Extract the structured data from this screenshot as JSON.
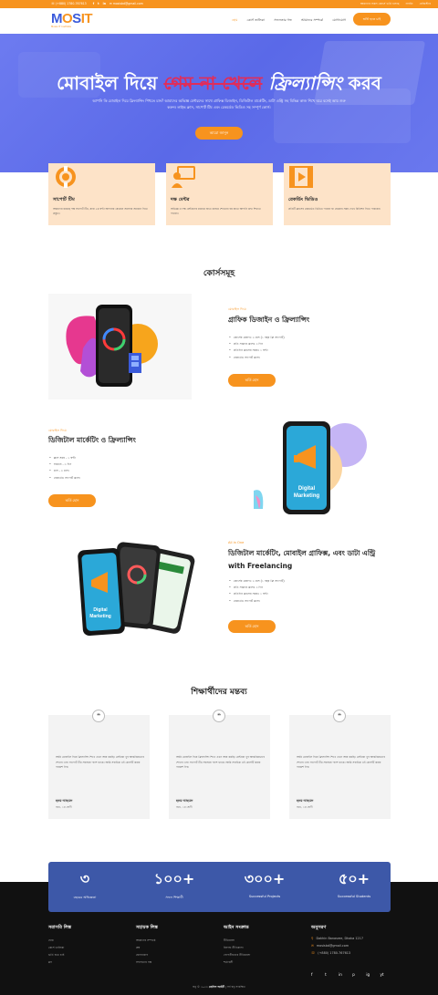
{
  "topbar": {
    "phone": "(+880) 1780-767613",
    "email": "mosisbd@gmail.com",
    "socials": [
      "f",
      "t",
      "in"
    ],
    "notice": "আমাদের সকল কোর্সে ভর্তি চলছে",
    "login": "লগইন",
    "register": "রেজিস্টার"
  },
  "logo": {
    "m": "M",
    "o": "O",
    "s": "S",
    "t": "IT",
    "tagline": "Mosis IT Institute"
  },
  "nav": {
    "items": [
      "হোম",
      "কোর্স তালিকা",
      "সফলতার গল্প",
      "আমাদের সম্পর্কে",
      "যোগাযোগ"
    ],
    "cta": "ভর্তি হতে চাই"
  },
  "hero": {
    "title_a": "মোবাইল দিয়ে",
    "title_strike": "গেম না খেলে",
    "title_b": "ফ্রিল্যান্সিং",
    "title_c": "করব",
    "desc": "আপনি কি মোবাইল দিয়ে ফ্রিল্যান্সিং শিখতে চান? আমাদের অভিজ্ঞ মেন্টরদের সাথে গ্রাফিক্স ডিজাইন, ডিজিটাল মার্কেটিং, ডাটা এন্ট্রি সহ বিভিন্ন কাজ শিখে ঘরে বসেই আয় শুরু করুন। লাইভ ক্লাস, সাপোর্ট টিম এবং রেকর্ডেড ভিডিও সহ সম্পূর্ণ কোর্স।",
    "button": "আরো জানুন"
  },
  "features": [
    {
      "icon": "support-icon",
      "title": "সাপোর্ট টিম",
      "desc": "আমাদের রয়েছে দক্ষ সাপোর্ট টিম, যারা ২৪ ঘন্টা আপনার যেকোন সমস্যার সমাধান দিতে প্রস্তুত।"
    },
    {
      "icon": "mentor-icon",
      "title": "দক্ষ মেন্টর",
      "desc": "অভিজ্ঞ ও দক্ষ মেন্টরদের মাধ্যমে হাতে কলমে শেখানো হয় যাতে আপনি দ্রুত শিখতে পারেন।"
    },
    {
      "icon": "video-icon",
      "title": "রেকর্ডিং ভিডিও",
      "desc": "প্রতিটি ক্লাসের রেকর্ডেড ভিডিও পাবেন যা যেকোন সময় দেখে রিভিশন দিতে পারবেন।"
    }
  ],
  "courses": {
    "section_title": "কোর্সসমূহ",
    "items": [
      {
        "tag": "মোবাইল দিয়ে",
        "title": "গ্রাফিক ডিজাইন ও ফ্রিল্যান্সিং",
        "points": [
          "কোর্সের মেয়াদঃ ৩ মাস (১ বছর ফ্রি সাপোর্ট)",
          "প্রতি সপ্তাহে ক্লাসঃ ৩ দিন",
          "প্রতিদিন ক্লাসের সময়ঃ ১ ঘন্টা",
          "রেকর্ডেড সাপোর্ট ক্লাস।"
        ],
        "button": "ভর্তি হোন"
      },
      {
        "tag": "মোবাইল দিয়ে",
        "title": "ডিজিটাল মার্কেটিং ও ফ্রিল্যান্সিং",
        "points": [
          "ক্লাস সময় - ১ ঘণ্টা",
          "সপ্তাহে - ৩ দিন",
          "মাস - ৩ মাস।",
          "রেকর্ডেড সাপোর্ট ক্লাস।"
        ],
        "button": "ভর্তি হোন",
        "phone_label": "Digital Marketing"
      },
      {
        "tag": "All in One",
        "title": "ডিজিটাল মার্কেটিং, মোবাইল গ্রাফিক্স, এবং ডাটা এন্ট্রি with Freelancing",
        "points": [
          "কোর্সের মেয়াদঃ ৩ মাস (১ বছর ফ্রি সাপোর্ট)",
          "প্রতি সপ্তাহে ক্লাসঃ ৩ দিন",
          "প্রতিদিন ক্লাসের সময়ঃ ১ ঘন্টা",
          "রেকর্ডেড সাপোর্ট ক্লাস।"
        ],
        "button": "ভর্তি হোন",
        "phone_label": "Digital Marketing"
      }
    ]
  },
  "testimonials": {
    "section_title": "শিক্ষার্থীদের মন্তব্য",
    "items": [
      {
        "text": "আমি মোবাইল দিয়ে ফ্রিল্যান্সিং শিখে এখন আয় করছি। মেন্টররা খুব আন্তরিকভাবে শেখান এবং সাপোর্ট টিম সবসময় পাশে থাকে। আমি সবাইকে এই কোর্সটি করার পরামর্শ দিব।",
        "name": "হৃদয় আহমেদ",
        "batch": "ব্যাচ, ১ম শ্রেণী"
      },
      {
        "text": "আমি মোবাইল দিয়ে ফ্রিল্যান্সিং শিখে এখন আয় করছি। মেন্টররা খুব আন্তরিকভাবে শেখান এবং সাপোর্ট টিম সবসময় পাশে থাকে। আমি সবাইকে এই কোর্সটি করার পরামর্শ দিব।",
        "name": "হৃদয় আহমেদ",
        "batch": "ব্যাচ, ১ম শ্রেণী"
      },
      {
        "text": "আমি মোবাইল দিয়ে ফ্রিল্যান্সিং শিখে এখন আয় করছি। মেন্টররা খুব আন্তরিকভাবে শেখান এবং সাপোর্ট টিম সবসময় পাশে থাকে। আমি সবাইকে এই কোর্সটি করার পরামর্শ দিব।",
        "name": "হৃদয় আহমেদ",
        "batch": "ব্যাচ, ১ম শ্রেণী"
      }
    ]
  },
  "stats": [
    {
      "num": "৩",
      "label": "বছরের অভিজ্ঞতা"
    },
    {
      "num": "১০০+",
      "label": "সফল শিক্ষার্থী"
    },
    {
      "num": "৩০০+",
      "label": "Successful Projects"
    },
    {
      "num": "৫০+",
      "label": "Successful Students"
    }
  ],
  "footer": {
    "cols": [
      {
        "title": "সরাসরি লিঙ্ক",
        "items": [
          "হোম",
          "কোর্স তালিকা",
          "ভর্তি হতে চাই",
          "ব্লগ"
        ]
      },
      {
        "title": "সহায়ক লিঙ্ক",
        "items": [
          "আমাদের সম্পর্কে",
          "প্রশ্ন",
          "যোগাযোগ",
          "সফলতার গল্প"
        ]
      },
      {
        "title": "আইন সংক্রান্ত",
        "items": [
          "নীতিমালা",
          "রিফান্ড নীতিমালা",
          "গোপনীয়তার নীতিমালা",
          "শর্তাবলী"
        ]
      }
    ],
    "contact": {
      "title": "অনুসরণ",
      "address": "Dakhin Banasree, Dhaka 1217",
      "email": "mosisbd@gmail.com",
      "phone": "(+880) 1780-767613"
    },
    "socials": [
      "f",
      "t",
      "in",
      "p",
      "ig",
      "yt"
    ],
    "copyright_a": "স্বত্ব © ২০২৩",
    "copyright_brand": "মোসিস আইটি",
    "copyright_b": "| সর্ব স্বত্ব সংরক্ষিত"
  },
  "colors": {
    "accent": "#f7931e",
    "brand_blue": "#3d58a8",
    "hero_blue": "#6370ee",
    "card_peach": "#fde3c8"
  }
}
